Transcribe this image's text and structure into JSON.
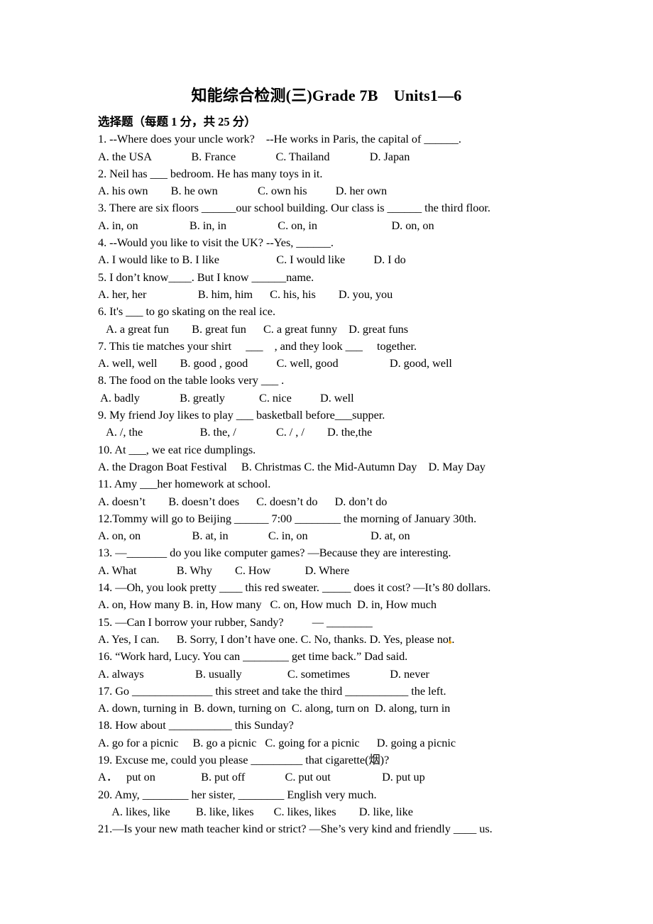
{
  "document": {
    "title": "知能综合检测(三)Grade 7B　Units1—6",
    "section_heading": "选择题（每题 1 分，共 25 分）"
  },
  "questions": [
    {
      "stem": "1. --Where does your uncle work?    --He works in Paris, the capital of ______.",
      "options": "A. the USA              B. France              C. Thailand              D. Japan",
      "indent_options": false
    },
    {
      "stem": "2. Neil has ___ bedroom. He has many toys in it.",
      "options": "A. his own        B. he own              C. own his          D. her own",
      "indent_options": false
    },
    {
      "stem": "3. There are six floors ______our school building. Our class is ______ the third floor.",
      "options": "A. in, on                  B. in, in                  C. on, in                          D. on, on",
      "indent_options": false
    },
    {
      "stem": "4. --Would you like to visit the UK? --Yes, ______.",
      "options": "A. I would like to B. I like                    C. I would like          D. I do",
      "indent_options": false
    },
    {
      "stem": "5. I don’t know____. But I know ______name.",
      "options": "A. her, her                  B. him, him      C. his, his        D. you, you",
      "indent_options": true
    },
    {
      "stem": "6. It's ___ to go skating on the real ice.",
      "options": "   A. a great fun        B. great fun      C. a great funny    D. great funs",
      "indent_options": true
    },
    {
      "stem": "7. This tie matches your shirt     ___    , and they look ___     together.",
      "options": "A. well, well        B. good , good          C. well, good                  D. good, well",
      "indent_options": false
    },
    {
      "stem": "8. The food on the table looks very ___ .",
      "options": " A. badly              B. greatly            C. nice          D. well",
      "indent_options": false
    },
    {
      "stem": "9. My friend Joy likes to play ___ basketball before___supper.",
      "options": "   A. /, the                    B. the, /              C. / , /        D. the,the",
      "indent_options": true
    },
    {
      "stem": "10. At ___, we eat rice dumplings.",
      "options": "A. the Dragon Boat Festival     B. Christmas C. the Mid-Autumn Day    D. May Day",
      "indent_options": false
    },
    {
      "stem": "11. Amy ___her homework at school.",
      "options": "A. doesn’t        B. doesn’t does      C. doesn’t do      D. don’t do",
      "indent_options": false
    },
    {
      "stem": "12.Tommy will go to Beijing ______ 7:00 ________ the morning of January 30th.",
      "options": "A. on, on                  B. at, in              C. in, on                      D. at, on",
      "indent_options": false
    },
    {
      "stem": "13. —_______ do you like computer games? —Because they are interesting.",
      "options": "A. What              B. Why        C. How            D. Where",
      "indent_options": false
    },
    {
      "stem": "14. —Oh, you look pretty ____ this red sweater. _____ does it cost? —It’s 80 dollars.",
      "options": "A. on, How many B. in, How many   C. on, How much  D. in, How much",
      "indent_options": false
    },
    {
      "stem": "15. —Can I borrow your rubber, Sandy?          — ________",
      "options_pre": "A. Yes, I can.      B. Sorry, I don’t have one. C. No, thanks. D. Yes, please no",
      "options_post": "t.",
      "has_artifact": true,
      "indent_options": false
    },
    {
      "stem": "16. “Work hard, Lucy. You can ________ get time back.” Dad said.",
      "options": "A. always                  B. usually                C. sometimes              D. never",
      "indent_options": false
    },
    {
      "stem": "17. Go ______________ this street and take the third ___________ the left.",
      "options": "A. down, turning in  B. down, turning on  C. along, turn on  D. along, turn in",
      "indent_options": false
    },
    {
      "stem": "18. How about ___________ this Sunday?",
      "options": "A. go for a picnic     B. go a picnic   C. going for a picnic      D. going a picnic",
      "indent_options": false
    },
    {
      "stem": "19. Excuse me, could you please _________ that cigarette(烟)?",
      "options": "A．   put on                B. put off              C. put out                  D. put up",
      "indent_options": false
    },
    {
      "stem": "20. Amy, ________ her sister, ________ English very much.",
      "options": "     A. likes, like         B. like, likes       C. likes, likes        D. like, like",
      "indent_options": true
    },
    {
      "stem": "21.—Is your new math teacher kind or strict? —She’s very kind and friendly ____ us.",
      "options": null,
      "indent_options": false
    }
  ]
}
